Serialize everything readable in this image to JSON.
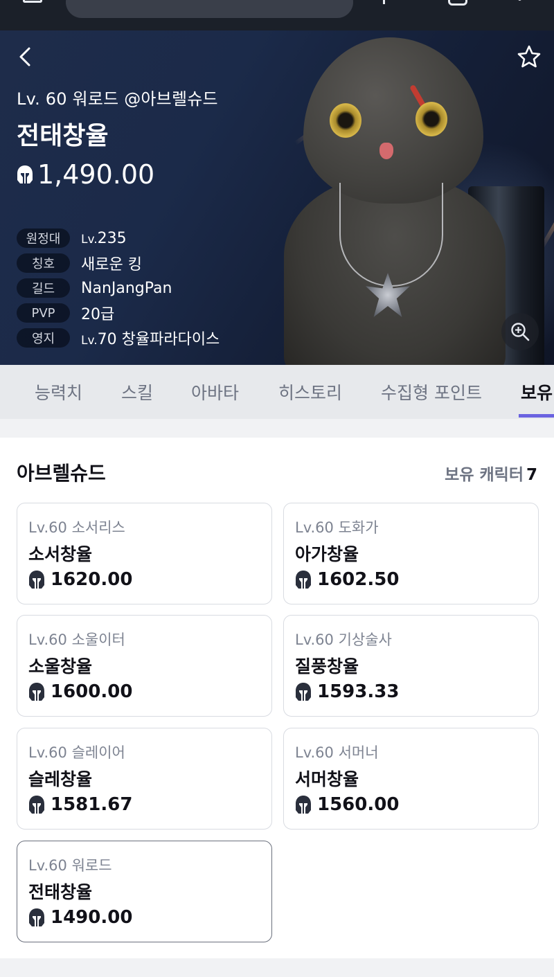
{
  "hero": {
    "subtitle": "Lv. 60 워로드 @아브렐슈드",
    "name": "전태창율",
    "item_level": "1,490.00",
    "info": [
      {
        "label": "원정대",
        "lv_prefix": "Lv.",
        "value": "235"
      },
      {
        "label": "칭호",
        "lv_prefix": "",
        "value": "새로운 킹"
      },
      {
        "label": "길드",
        "lv_prefix": "",
        "value": "NanJangPan"
      },
      {
        "label": "PVP",
        "lv_prefix": "",
        "value": "20급"
      },
      {
        "label": "영지",
        "lv_prefix": "Lv.",
        "value": "70 창율파라다이스"
      }
    ],
    "icons": {
      "back": "chevron-left-icon",
      "favorite": "star-outline-icon",
      "zoom": "zoom-in-icon",
      "item_level": "helmet-icon"
    }
  },
  "tabs": [
    {
      "label": "능력치",
      "active": false
    },
    {
      "label": "스킬",
      "active": false
    },
    {
      "label": "아바타",
      "active": false
    },
    {
      "label": "히스토리",
      "active": false
    },
    {
      "label": "수집형 포인트",
      "active": false
    },
    {
      "label": "보유",
      "active": true
    }
  ],
  "roster": {
    "server": "아브렐슈드",
    "owned_label": "보유 캐릭터",
    "owned_count": "7",
    "characters": [
      {
        "level": "Lv.60 소서리스",
        "name": "소서창율",
        "item_level": "1620.00",
        "selected": false
      },
      {
        "level": "Lv.60 도화가",
        "name": "아가창율",
        "item_level": "1602.50",
        "selected": false
      },
      {
        "level": "Lv.60 소울이터",
        "name": "소울창율",
        "item_level": "1600.00",
        "selected": false
      },
      {
        "level": "Lv.60 기상술사",
        "name": "질풍창율",
        "item_level": "1593.33",
        "selected": false
      },
      {
        "level": "Lv.60 슬레이어",
        "name": "슬레창율",
        "item_level": "1581.67",
        "selected": false
      },
      {
        "level": "Lv.60 서머너",
        "name": "서머창율",
        "item_level": "1560.00",
        "selected": false
      },
      {
        "level": "Lv.60 워로드",
        "name": "전태창율",
        "item_level": "1490.00",
        "selected": true
      }
    ]
  },
  "colors": {
    "accent": "#6a63e0",
    "hero_bg": "#1b2a49",
    "muted_text": "#6d7382"
  }
}
